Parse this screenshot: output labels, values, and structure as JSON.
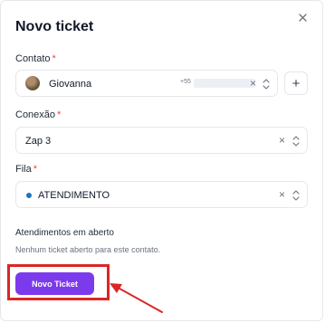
{
  "modal": {
    "title": "Novo ticket",
    "close_icon": "close-icon"
  },
  "contato": {
    "label": "Contato",
    "required_mark": "*",
    "name": "Giovanna",
    "phone_prefix": "+55",
    "add_label": "+"
  },
  "conexao": {
    "label": "Conexão",
    "required_mark": "*",
    "value": "Zap 3"
  },
  "fila": {
    "label": "Fila",
    "required_mark": "*",
    "value": "ATENDIMENTO",
    "dot_color": "#1d74c4"
  },
  "atendimentos": {
    "title": "Atendimentos em aberto",
    "empty_text": "Nenhum ticket aberto para este contato."
  },
  "actions": {
    "submit_label": "Novo Ticket",
    "accent_color": "#7c3aed",
    "highlight_color": "#dc2626"
  },
  "icons": {
    "clear": "×"
  }
}
